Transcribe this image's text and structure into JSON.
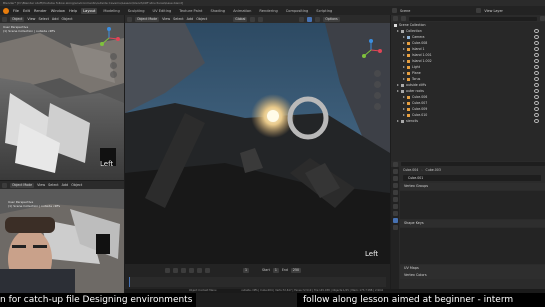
{
  "window": {
    "title": "Blender* [D:\\Blender stuff\\Youtube follow along\\environments\\outside Caverns\\Lesson\\blend\\Cliff structures\\base.blend]"
  },
  "menubar": {
    "menus": [
      "File",
      "Edit",
      "Render",
      "Window",
      "Help"
    ],
    "workspaces": [
      "Layout",
      "Modeling",
      "Sculpting",
      "UV Editing",
      "Texture Paint",
      "Shading",
      "Animation",
      "Rendering",
      "Compositing",
      "Scripting"
    ],
    "active_workspace": "Layout",
    "scene_label": "Scene",
    "view_layer_label": "View Layer"
  },
  "left_top_viewport": {
    "mode": "Object",
    "menus": [
      "View",
      "Select",
      "Add",
      "Object"
    ],
    "transform": "Global",
    "info_line1": "User Perspective",
    "info_line2": "(1) Scene Collection | outside cliffs",
    "axis_label": "Left"
  },
  "left_bottom_viewport": {
    "mode": "Object Mode",
    "menus": [
      "View",
      "Select",
      "Add",
      "Object"
    ],
    "transform": "Global",
    "info_line1": "User Perspective",
    "info_line2": "(1) Scene Collection | outside cliffs"
  },
  "main_viewport": {
    "mode": "Object Mode",
    "menus": [
      "View",
      "Select",
      "Add",
      "Object"
    ],
    "transform": "Global",
    "options_label": "Options",
    "axis_label": "Left"
  },
  "outliner": {
    "root": "Scene Collection",
    "items": [
      {
        "label": "Collection",
        "color": "#aaaaaa"
      },
      {
        "label": "Camera",
        "color": "#8fb4d8"
      },
      {
        "label": "Cube.008",
        "color": "#e8a040"
      },
      {
        "label": "Island 1",
        "color": "#e8a040"
      },
      {
        "label": "Island 1.001",
        "color": "#e8a040"
      },
      {
        "label": "Island 1.002",
        "color": "#e8a040"
      },
      {
        "label": "Light",
        "color": "#e8a040"
      },
      {
        "label": "Plane",
        "color": "#e8a040"
      },
      {
        "label": "Torus",
        "color": "#e8a040"
      },
      {
        "label": "outside cliffs",
        "color": "#aaaaaa"
      },
      {
        "label": "outer rocks",
        "color": "#aaaaaa"
      },
      {
        "label": "Cube.006",
        "color": "#e8a040"
      },
      {
        "label": "Cube.007",
        "color": "#e8a040"
      },
      {
        "label": "Cube.009",
        "color": "#e8a040"
      },
      {
        "label": "Cube.010",
        "color": "#e8a040"
      },
      {
        "label": "stencils",
        "color": "#aaaaaa"
      }
    ]
  },
  "properties": {
    "object_tab_a": "Cube.004",
    "object_tab_b": "Cube.003",
    "mesh_name": "Cube.001",
    "panels": [
      "Vertex Groups",
      "Shape Keys",
      "UV Maps",
      "Vertex Colors"
    ]
  },
  "timeline": {
    "current_frame": "1",
    "start_label": "Start",
    "start_value": "1",
    "end_label": "End",
    "end_value": "250"
  },
  "status": {
    "left": "Object Context Menu",
    "right": "outside cliffs | Cube.004 | Verts:72,617 | Faces:72,519 | Tris:145,038 | Objects:1/25 | Mem: 173.7 MiB | 2.90.0"
  },
  "subtitles": {
    "left": "n for catch-up file Designing environments",
    "right": "follow along lesson aimed at beginner - interm"
  },
  "colors": {
    "accent_blue": "#4772b3",
    "blender_orange": "#e87d0d",
    "gizmo_x": "#e04556",
    "gizmo_y": "#7fc23d",
    "gizmo_z": "#3b8ee0"
  }
}
